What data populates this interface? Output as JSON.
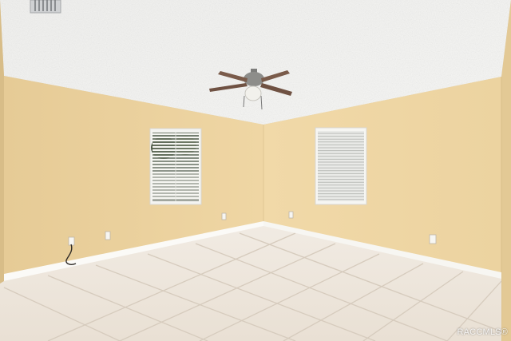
{
  "scene": {
    "description_kind": "empty-room-photo",
    "objects": [
      "textured-ceiling",
      "ceiling-fan",
      "ceiling-vent",
      "left-window-with-blinds",
      "right-window-with-blinds",
      "beige-walls",
      "white-baseboard",
      "tile-floor",
      "electrical-outlets",
      "loose-cable"
    ]
  },
  "watermark": {
    "text": "RACCMLS®"
  },
  "colors": {
    "ceiling": "#f3f3f1",
    "wall_left": "#ecd3a1",
    "wall_back": "#f0d9a8",
    "wall_right": "#f2daa9",
    "floor": "#ece4da",
    "grout": "#d7ccbf",
    "baseboard": "#fbfaf7",
    "blinds": "#f2f2ee",
    "fan_blade": "#7a5b4a",
    "fan_body": "#8a8a88"
  }
}
